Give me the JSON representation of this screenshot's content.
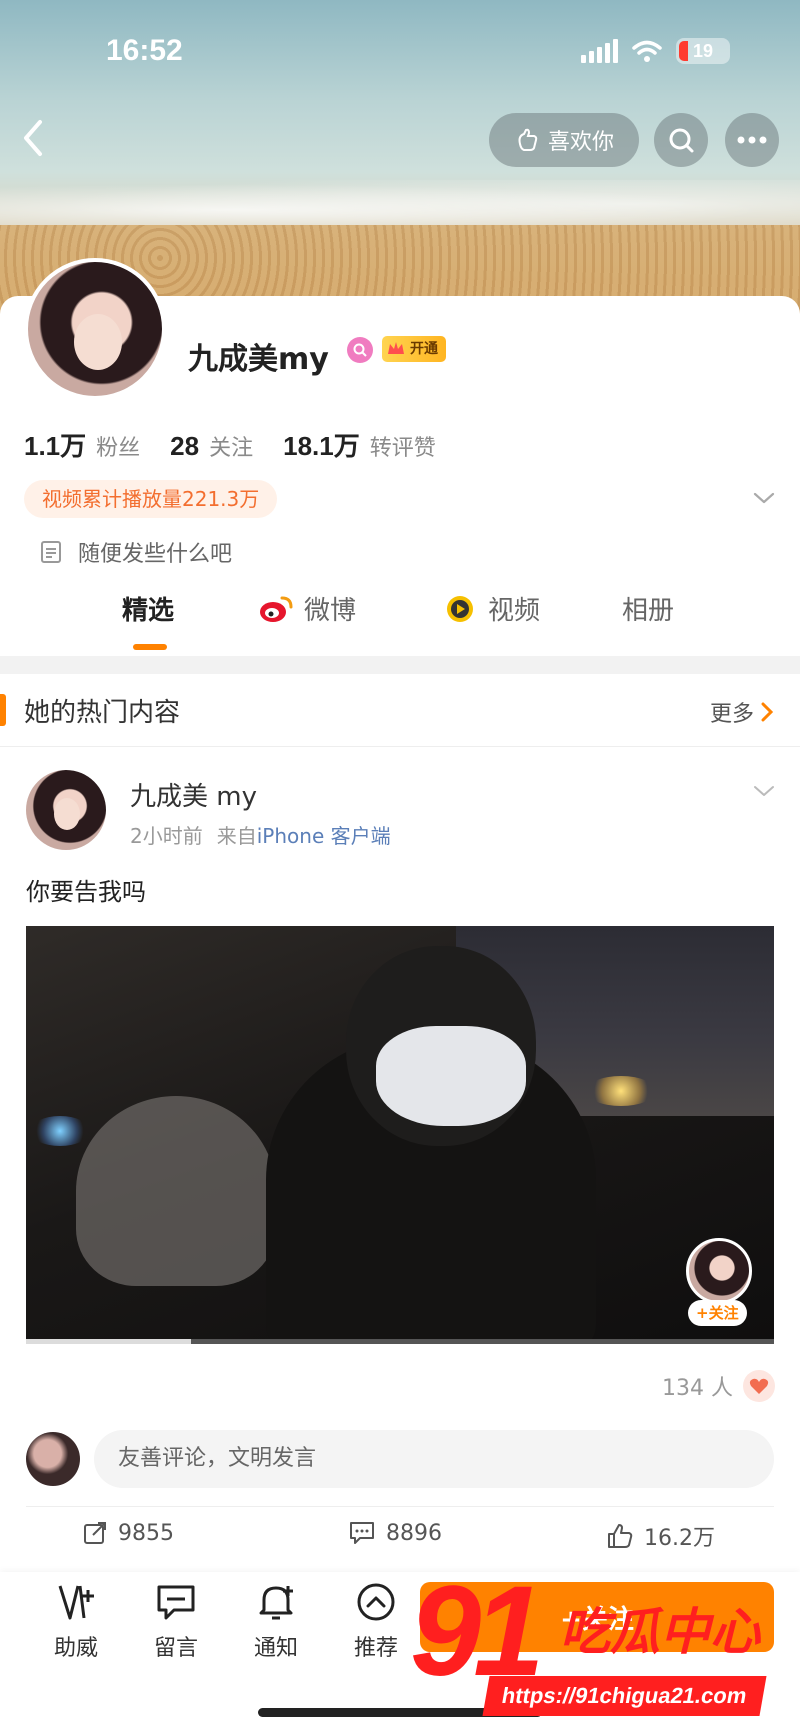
{
  "status_bar": {
    "time": "16:52",
    "battery": "19"
  },
  "header": {
    "like_label": "喜欢你"
  },
  "profile": {
    "name": "九成美my",
    "vip_label": "开通",
    "stats": [
      {
        "value": "1.1万",
        "label": "粉丝"
      },
      {
        "value": "28",
        "label": "关注"
      },
      {
        "value": "18.1万",
        "label": "转评赞"
      }
    ],
    "play_count_tag": "视频累计播放量221.3万",
    "bio": "随便发些什么吧"
  },
  "tabs": [
    {
      "label": "精选",
      "icon": "none"
    },
    {
      "label": "微博",
      "icon": "weibo-icon"
    },
    {
      "label": "视频",
      "icon": "video-icon"
    },
    {
      "label": "相册",
      "icon": "none"
    }
  ],
  "hot": {
    "title": "她的热门内容",
    "more": "更多"
  },
  "post": {
    "author": "九成美 my",
    "time": "2小时前",
    "source_prefix": "来自",
    "source": "iPhone 客户端",
    "text": "你要告我吗",
    "video_follow": "+关注",
    "video_progress": 0.22,
    "viewers": "134 人",
    "comment_placeholder": "友善评论，文明发言",
    "reposts": "9855",
    "comments": "8896",
    "likes": "16.2万"
  },
  "bottom_bar": {
    "items": [
      {
        "label": "助威",
        "icon": "cheer-icon"
      },
      {
        "label": "留言",
        "icon": "message-icon"
      },
      {
        "label": "通知",
        "icon": "bell-icon"
      },
      {
        "label": "推荐",
        "icon": "recommend-icon"
      }
    ],
    "follow_label": "+关注"
  },
  "watermark": {
    "number": "91",
    "brand": "吃瓜中心",
    "url": "https://91chigua21.com"
  },
  "colors": {
    "accent": "#ff8200",
    "tag_text": "#f36e2f",
    "link": "#5b7fb8",
    "watermark": "#ff1f1f"
  }
}
